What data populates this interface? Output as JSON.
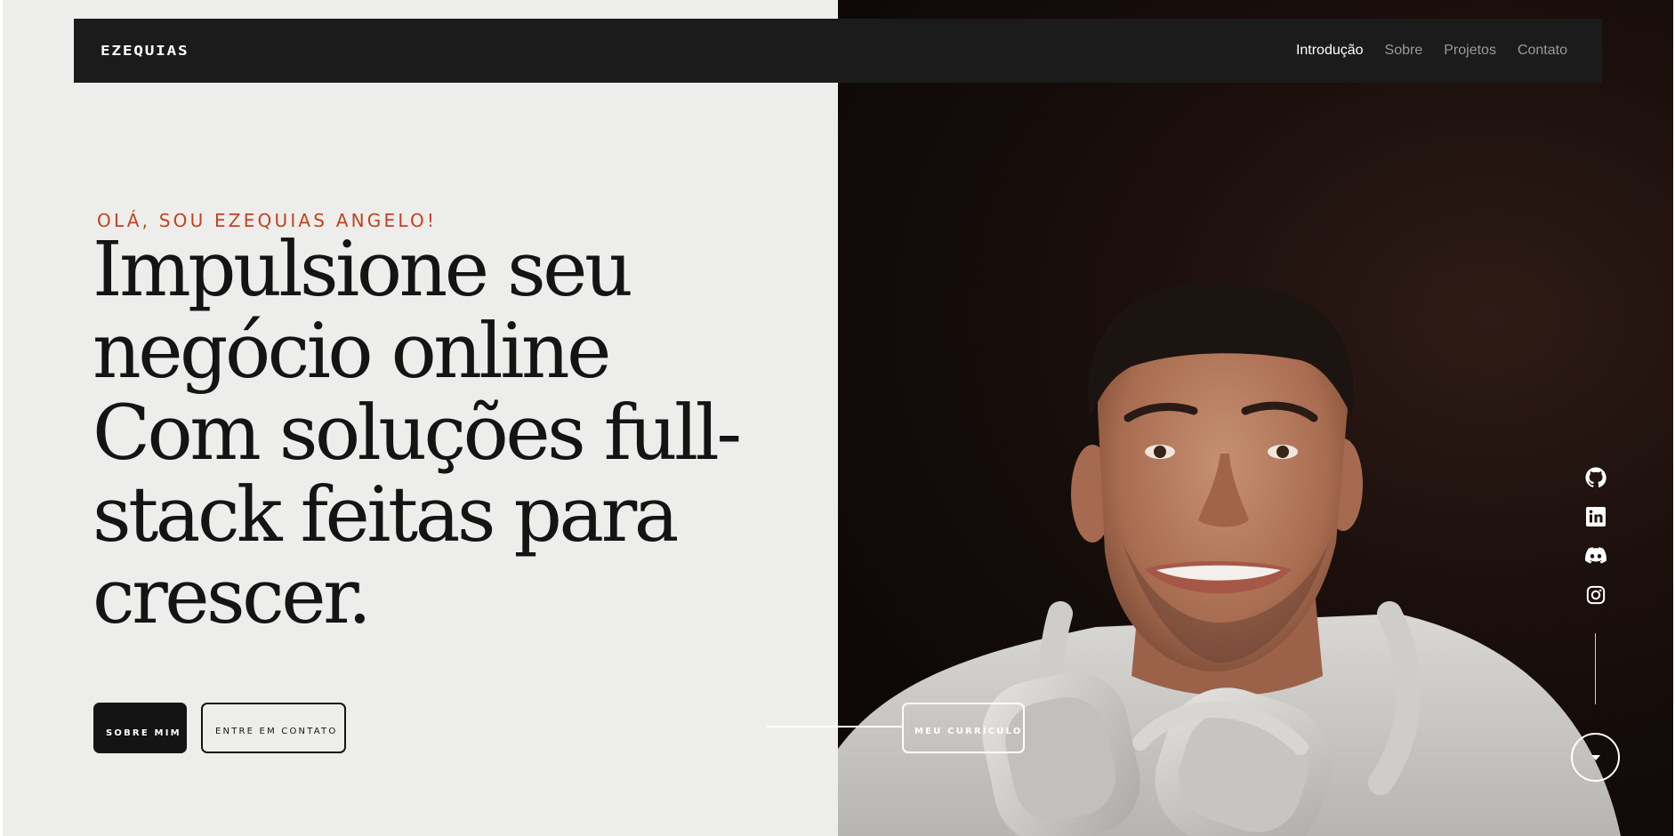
{
  "navbar": {
    "logo": "EZEQUIAS",
    "links": [
      {
        "label": "Introdução",
        "active": true
      },
      {
        "label": "Sobre",
        "active": false
      },
      {
        "label": "Projetos",
        "active": false
      },
      {
        "label": "Contato",
        "active": false
      }
    ]
  },
  "hero": {
    "eyebrow": "OLÁ, SOU EZEQUIAS ANGELO!",
    "headline": "Impulsione seu negócio online Com soluções full-stack feitas para crescer.",
    "buttons": {
      "about": "SOBRE MIM",
      "contact": "ENTRE EM CONTATO",
      "resume": "MEU CURRÍCULO"
    }
  },
  "social": {
    "icons": [
      "github-icon",
      "linkedin-icon",
      "discord-icon",
      "instagram-icon"
    ]
  },
  "scroll": {
    "icon": "caret-down-icon"
  },
  "colors": {
    "accent": "#c4411d",
    "dark": "#141414",
    "navbar": "#1b1b1b",
    "light_background": "#edeeeb",
    "nav_inactive": "#9a9a9a"
  }
}
